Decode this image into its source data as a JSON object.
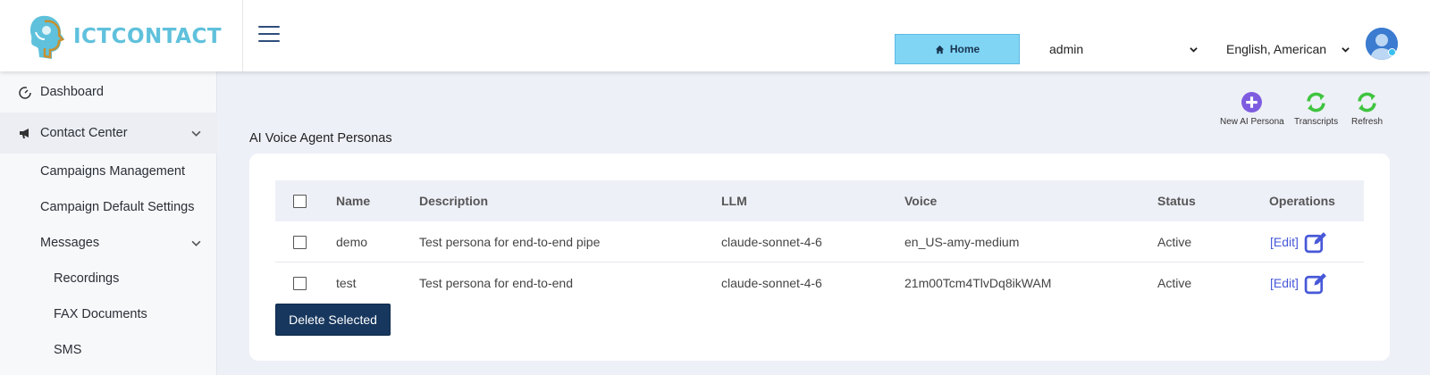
{
  "brand": {
    "logo_text": "ICTCONTACT"
  },
  "header": {
    "home_label": "Home",
    "user_select": "admin",
    "language_select": "English, American"
  },
  "sidebar": {
    "items": [
      {
        "label": "Dashboard"
      },
      {
        "label": "Contact Center"
      },
      {
        "label": "Campaigns Management"
      },
      {
        "label": "Campaign Default Settings"
      },
      {
        "label": "Messages"
      },
      {
        "label": "Recordings"
      },
      {
        "label": "FAX Documents"
      },
      {
        "label": "SMS"
      }
    ]
  },
  "page": {
    "title": "AI Voice Agent Personas"
  },
  "toolbar": {
    "new_persona": "New AI Persona",
    "transcripts": "Transcripts",
    "refresh": "Refresh"
  },
  "table": {
    "headers": {
      "name": "Name",
      "description": "Description",
      "llm": "LLM",
      "voice": "Voice",
      "status": "Status",
      "operations": "Operations"
    },
    "rows": [
      {
        "name": "demo",
        "description": "Test persona for end-to-end pipe",
        "llm": "claude-sonnet-4-6",
        "voice": "en_US-amy-medium",
        "status": "Active",
        "edit": "[Edit]"
      },
      {
        "name": "test",
        "description": "Test persona for end-to-end",
        "llm": "claude-sonnet-4-6",
        "voice": "21m00Tcm4TlvDq8ikWAM",
        "status": "Active",
        "edit": "[Edit]"
      }
    ]
  },
  "actions": {
    "delete_selected": "Delete Selected"
  },
  "colors": {
    "accent": "#4758d8",
    "primary_button": "#17375e",
    "home_button": "#80d5f5",
    "icon_green": "#3fc43f",
    "icon_purple": "#7d5ce0"
  }
}
